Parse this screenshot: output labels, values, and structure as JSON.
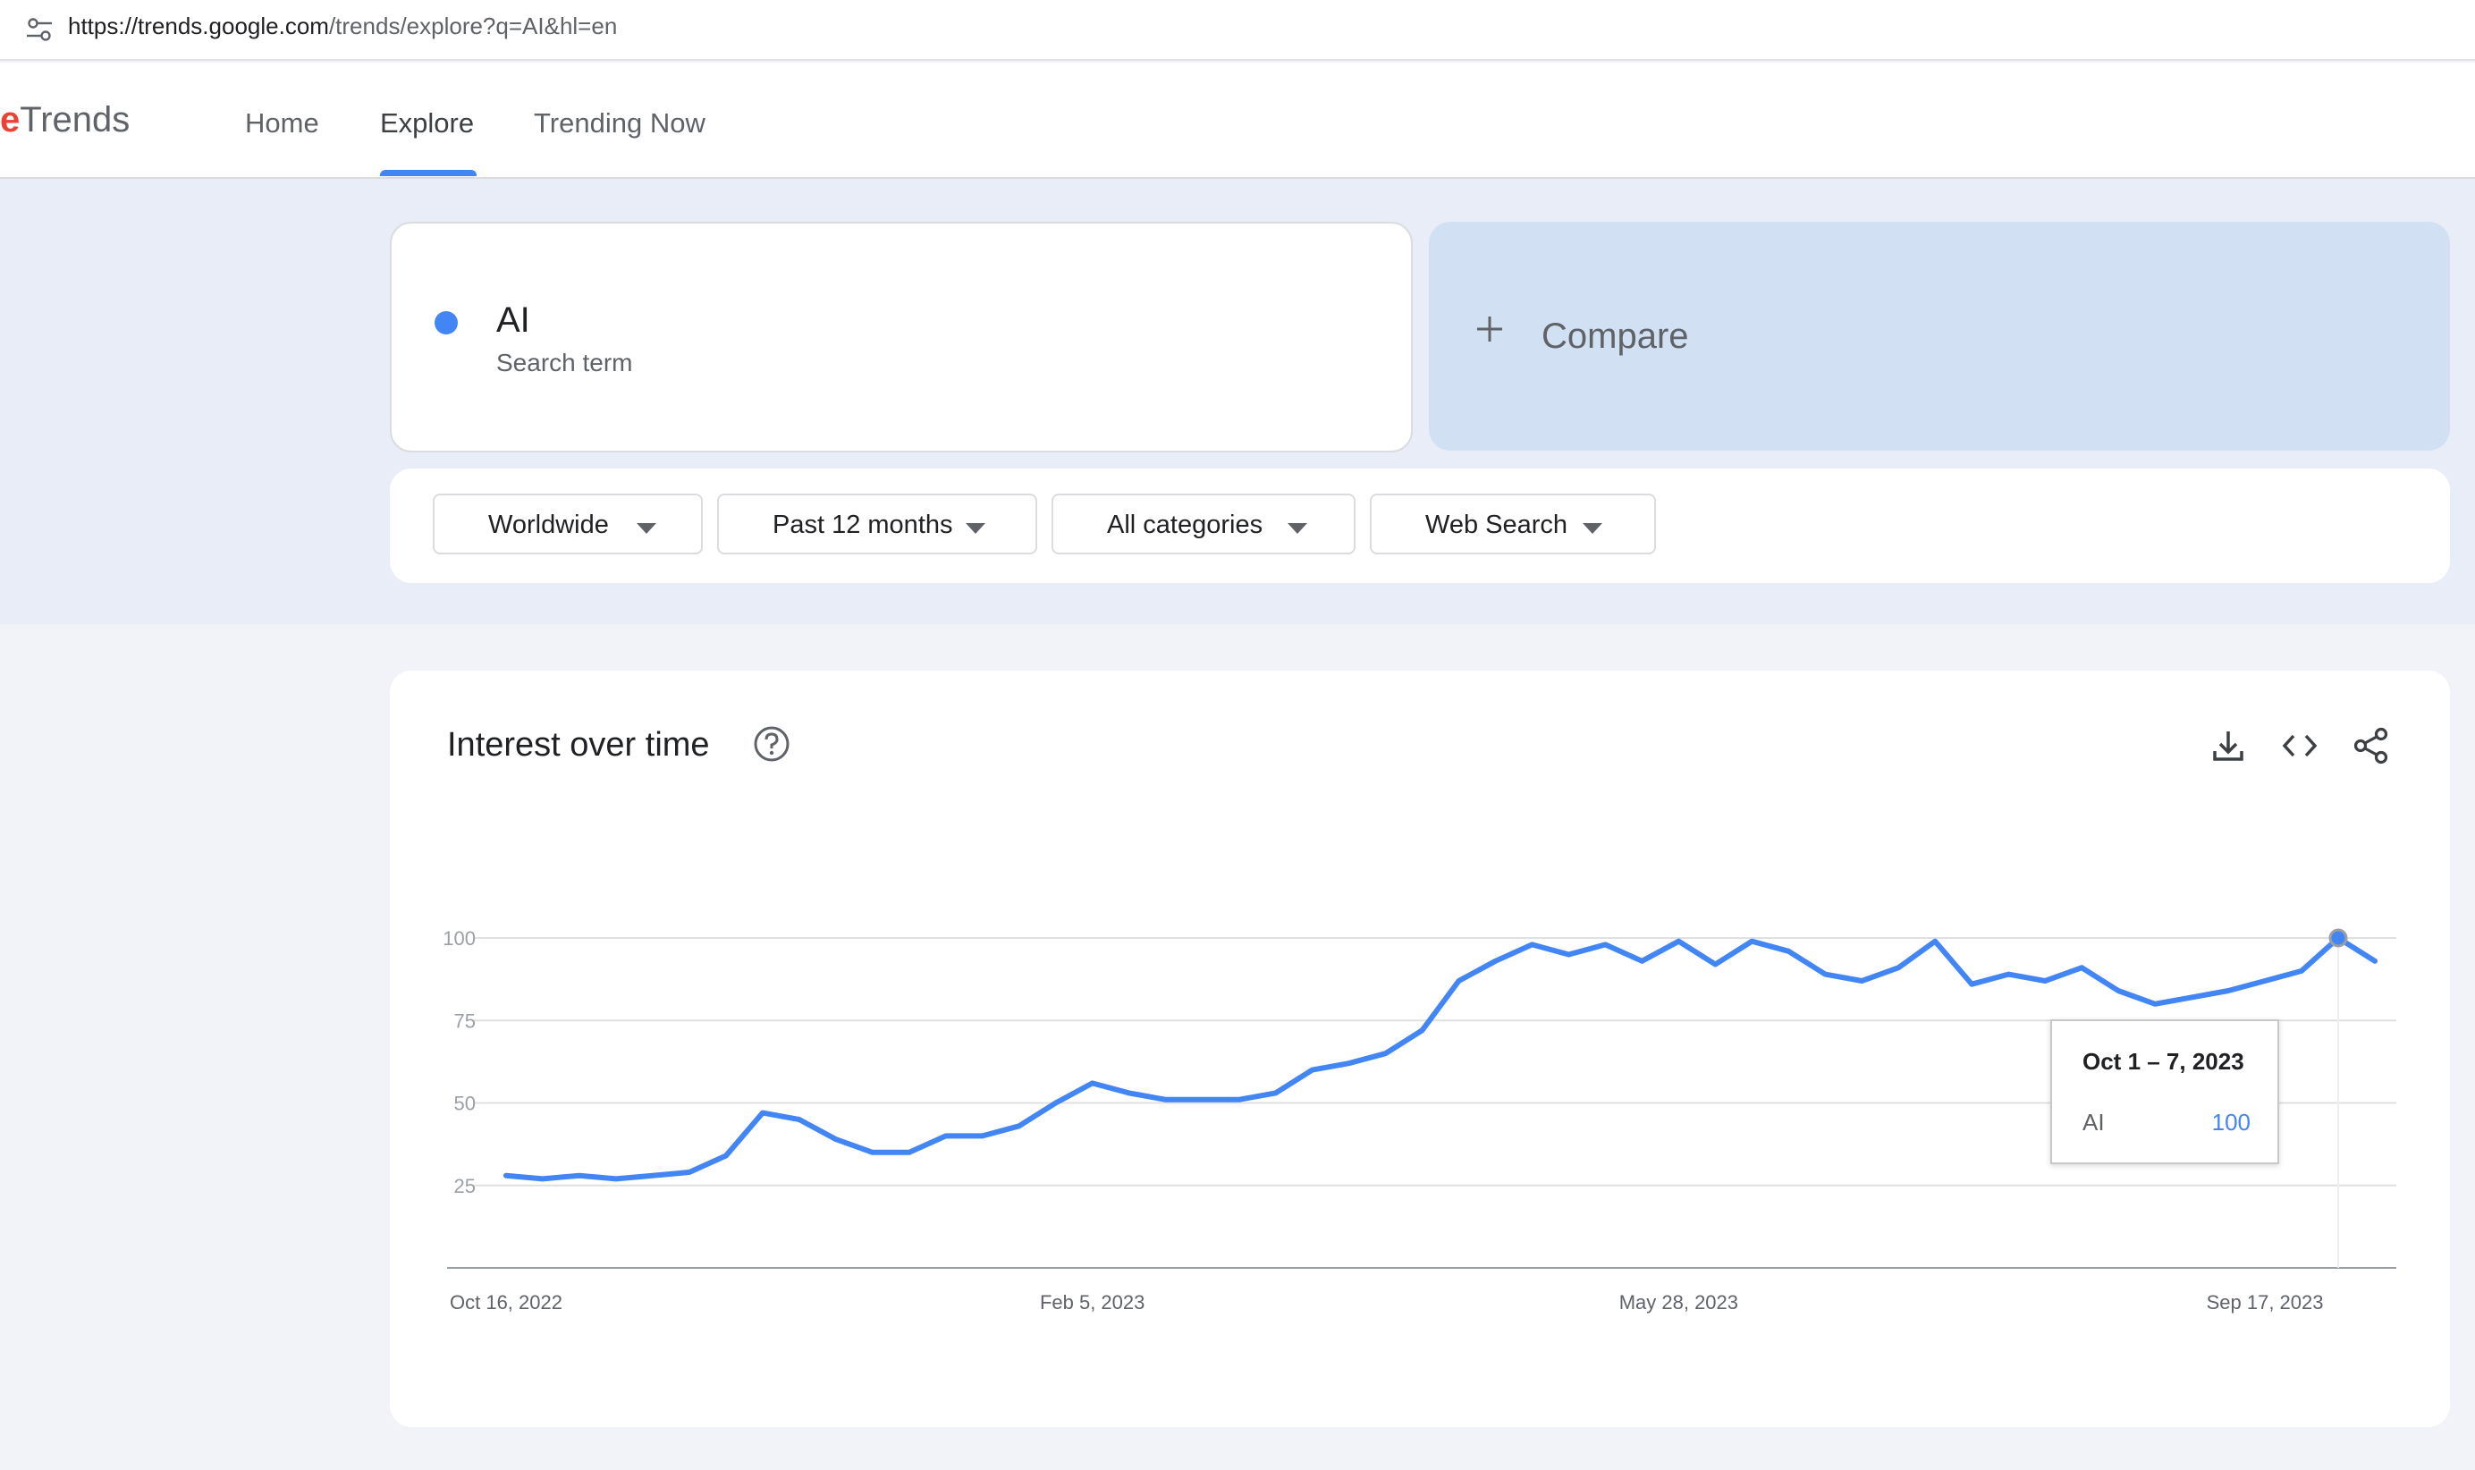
{
  "browser": {
    "url_host": "https://trends.google.com",
    "url_path": "/trends/explore?q=AI&hl=en"
  },
  "header": {
    "logo_g": "e",
    "logo_text": "Trends",
    "nav": [
      "Home",
      "Explore",
      "Trending Now"
    ],
    "active_tab": "Explore"
  },
  "search_term": {
    "name": "AI",
    "subtitle": "Search term",
    "color": "#4285f4"
  },
  "compare": {
    "label": "Compare"
  },
  "filters": {
    "region": "Worldwide",
    "time": "Past 12 months",
    "category": "All categories",
    "property": "Web Search"
  },
  "interest": {
    "title": "Interest over time"
  },
  "tooltip": {
    "date": "Oct 1 – 7, 2023",
    "term": "AI",
    "value": "100"
  },
  "chart_data": {
    "type": "line",
    "title": "Interest over time",
    "x_start": "Oct 16, 2022",
    "x_step_days": 7,
    "x_tick_labels": [
      "Oct 16, 2022",
      "Feb 5, 2023",
      "May 28, 2023",
      "Sep 17, 2023"
    ],
    "x_tick_index": [
      0,
      16,
      32,
      48
    ],
    "y_ticks": [
      25,
      50,
      75,
      100
    ],
    "ylim": [
      0,
      100
    ],
    "grid": true,
    "series": [
      {
        "name": "AI",
        "color": "#4285f4",
        "values": [
          28,
          27,
          28,
          27,
          28,
          29,
          34,
          47,
          45,
          39,
          35,
          35,
          40,
          40,
          43,
          50,
          56,
          53,
          51,
          51,
          51,
          53,
          60,
          62,
          65,
          72,
          87,
          93,
          98,
          95,
          98,
          93,
          99,
          92,
          99,
          96,
          89,
          87,
          91,
          99,
          86,
          89,
          87,
          91,
          84,
          80,
          82,
          84,
          87,
          90,
          100,
          93
        ]
      }
    ],
    "highlight_index": 50
  }
}
